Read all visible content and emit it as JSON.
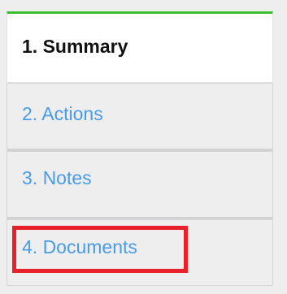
{
  "tabs": [
    {
      "label": "1. Summary",
      "state": "active"
    },
    {
      "label": "2. Actions",
      "state": "inactive"
    },
    {
      "label": "3. Notes",
      "state": "inactive"
    },
    {
      "label": "4. Documents",
      "state": "inactive",
      "highlighted": true
    }
  ],
  "colors": {
    "active_accent": "#3cbf2f",
    "link": "#4a9be6",
    "highlight": "#e8202a"
  }
}
